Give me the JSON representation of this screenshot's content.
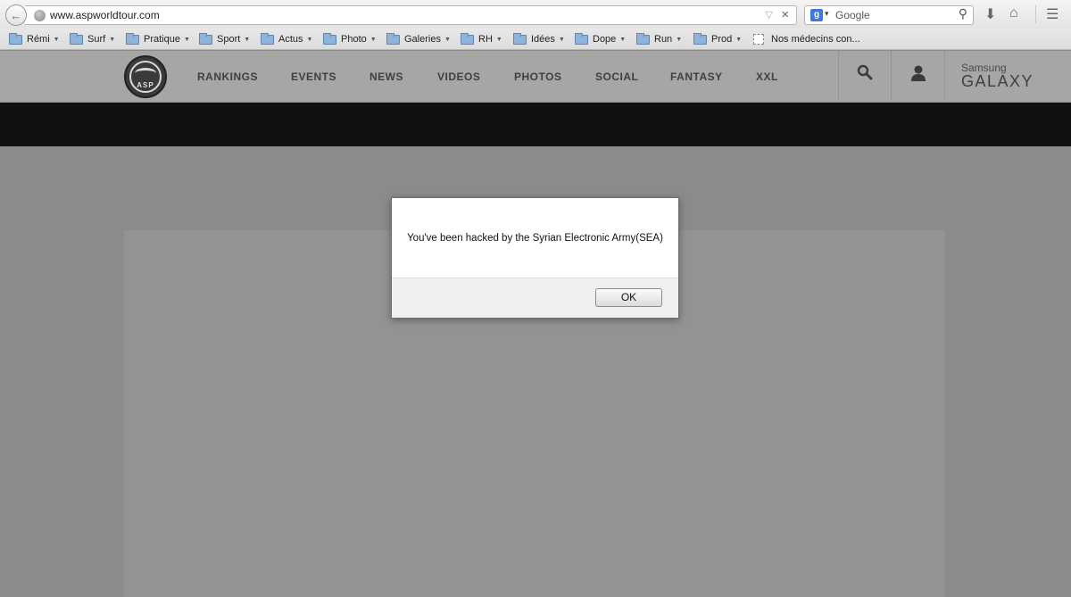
{
  "browser": {
    "url": "www.aspworldtour.com",
    "search_placeholder": "Google",
    "search_engine_letter": "g",
    "bookmarks": [
      {
        "label": "Rémi"
      },
      {
        "label": "Surf"
      },
      {
        "label": "Pratique"
      },
      {
        "label": "Sport"
      },
      {
        "label": "Actus"
      },
      {
        "label": "Photo"
      },
      {
        "label": "Galeries"
      },
      {
        "label": "RH"
      },
      {
        "label": "Idées"
      },
      {
        "label": "Dope"
      },
      {
        "label": "Run"
      },
      {
        "label": "Prod"
      }
    ],
    "bookmark_page": "Nos médecins con..."
  },
  "site": {
    "logo_text": "ASP",
    "nav": [
      "RANKINGS",
      "EVENTS",
      "NEWS",
      "VIDEOS",
      "PHOTOS",
      "SOCIAL",
      "FANTASY",
      "XXL"
    ],
    "sponsor_line1": "Samsung",
    "sponsor_line2": "GALAXY"
  },
  "dialog": {
    "message": "You've been hacked by the Syrian Electronic Army(SEA)",
    "ok_label": "OK"
  }
}
